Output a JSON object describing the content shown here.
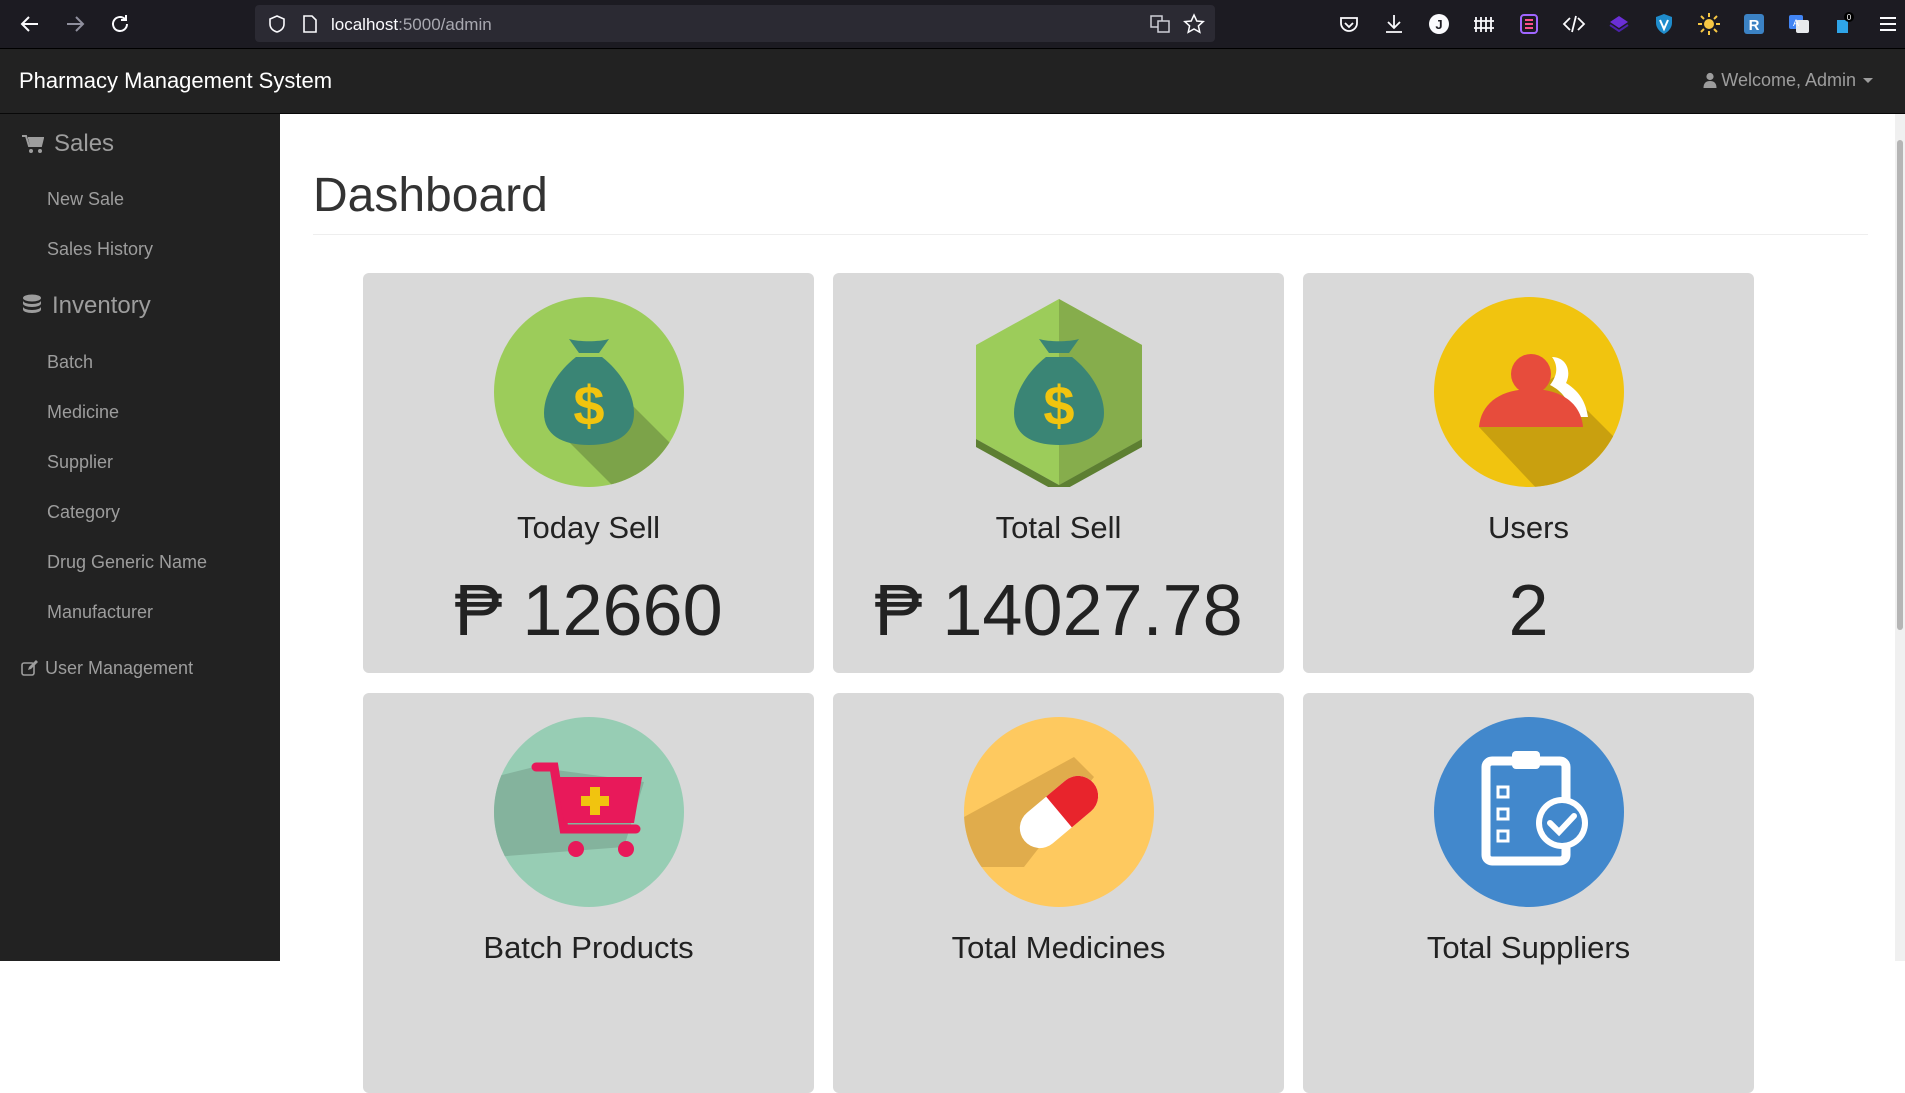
{
  "browser": {
    "url_host": "localhost",
    "url_path": ":5000/admin",
    "badge_count": "0"
  },
  "navbar": {
    "brand": "Pharmacy Management System",
    "welcome": "Welcome, Admin"
  },
  "sidebar": {
    "sales_heading": "Sales",
    "sales_items": [
      "New Sale",
      "Sales History"
    ],
    "inventory_heading": "Inventory",
    "inventory_items": [
      "Batch",
      "Medicine",
      "Supplier",
      "Category",
      "Drug Generic Name",
      "Manufacturer"
    ],
    "user_management": "User Management"
  },
  "main": {
    "title": "Dashboard",
    "cards": [
      {
        "label": "Today Sell",
        "value": "₱ 12660",
        "icon": "money-bag-icon",
        "color": "#9ccc5a"
      },
      {
        "label": "Total Sell",
        "value": "₱ 14027.78",
        "icon": "money-bag-hexagon-icon",
        "color": "#9ccc5a"
      },
      {
        "label": "Users",
        "value": "2",
        "icon": "users-icon",
        "color": "#f1c40f"
      },
      {
        "label": "Batch Products",
        "icon": "cart-icon",
        "color": "#97cdb4"
      },
      {
        "label": "Total Medicines",
        "icon": "pill-icon",
        "color": "#fec95f"
      },
      {
        "label": "Total Suppliers",
        "icon": "clipboard-check-icon",
        "color": "#4288cc"
      }
    ]
  }
}
